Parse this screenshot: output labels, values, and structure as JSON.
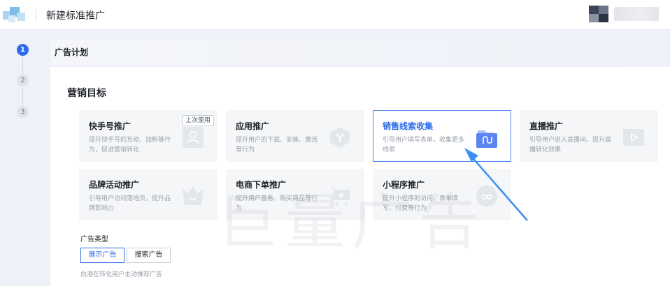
{
  "header": {
    "title": "新建标准推广"
  },
  "stepper": {
    "steps": [
      "1",
      "2",
      "3"
    ],
    "current": 1
  },
  "section": {
    "title": "广告计划"
  },
  "marketing": {
    "title": "营销目标",
    "cards": [
      {
        "title": "快手号推广",
        "desc": "提升快手号的互动、加粉等行为，促进营销转化",
        "icon": "user-icon",
        "badge": "上次使用",
        "selected": false
      },
      {
        "title": "应用推广",
        "desc": "提升用户的下载、安装、激活等行为",
        "icon": "app-icon",
        "selected": false
      },
      {
        "title": "销售线索收集",
        "desc": "引导用户填写表单，收集更多线索",
        "icon": "folder-icon",
        "selected": true
      },
      {
        "title": "直播推广",
        "desc": "引导用户进入直播间，提升直播转化效果",
        "icon": "play-icon",
        "selected": false
      },
      {
        "title": "品牌活动推广",
        "desc": "引导用户访问落地页，提升品牌影响力",
        "icon": "crown-icon",
        "selected": false
      },
      {
        "title": "电商下单推广",
        "desc": "提升用户查看、购买商品等行为",
        "icon": "cart-icon",
        "selected": false
      },
      {
        "title": "小程序推广",
        "desc": "提升小程序的访问、表单填写、付费等行为",
        "icon": "mini-program-icon",
        "selected": false
      }
    ]
  },
  "ad_type": {
    "label": "广告类型",
    "options": [
      "展示广告",
      "搜索广告"
    ],
    "selected": "展示广告",
    "hint": "向潜在转化用户主动推荐广告"
  },
  "watermark": "巨量广告",
  "colors": {
    "primary": "#2e6bec",
    "selected_border": "#4d86f0",
    "card_bg": "#f5f6f8",
    "page_bg": "#eef1f7"
  }
}
